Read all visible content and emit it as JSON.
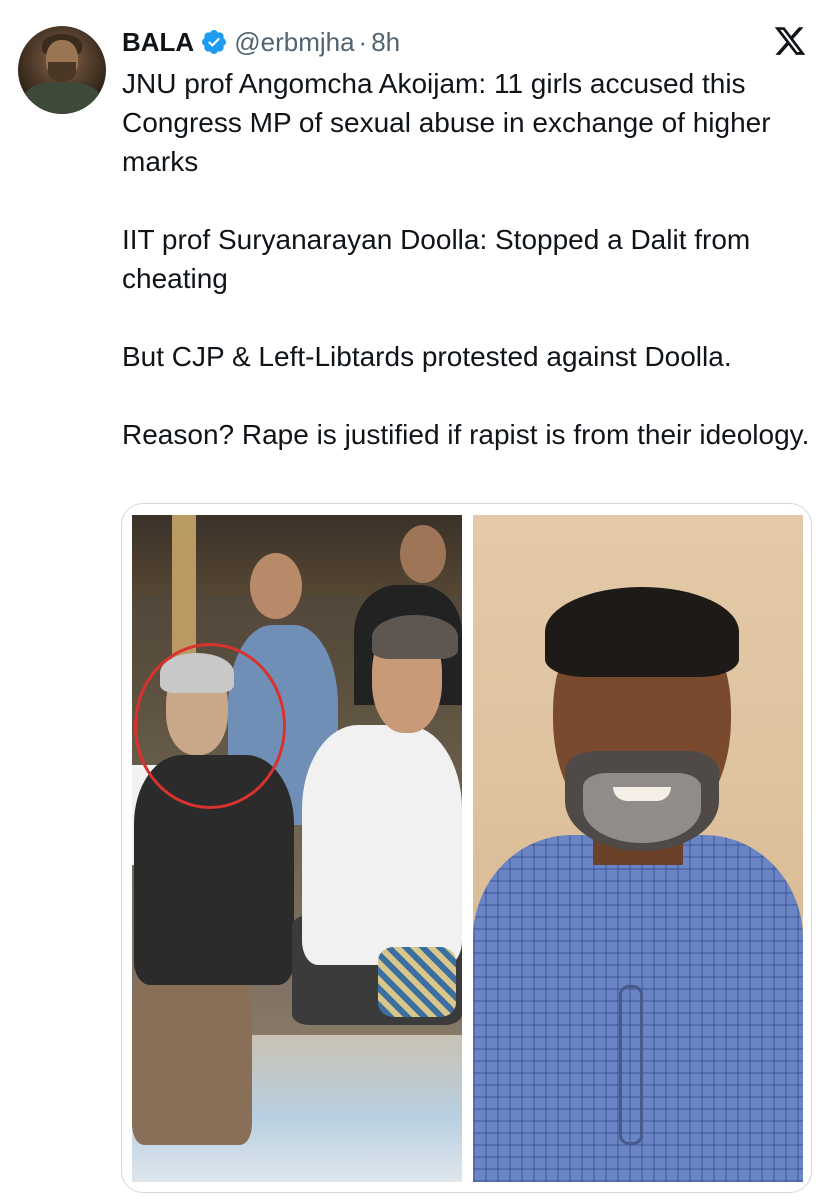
{
  "tweet": {
    "author_name": "BALA",
    "handle": "@erbmjha",
    "separator": "·",
    "time": "8h",
    "paragraphs": [
      "JNU prof Angomcha Akoijam: 11 girls accused this Congress MP of sexual abuse in exchange of higher marks",
      "IIT prof Suryanarayan Doolla: Stopped a Dalit from cheating",
      "But CJP & Left-Libtards protested against Doolla.",
      "Reason? Rape is justified if rapist is from their ideology."
    ]
  },
  "icons": {
    "verified": "verified-badge-icon",
    "platform": "x-logo-icon"
  },
  "colors": {
    "text": "#0f1419",
    "secondary_text": "#536471",
    "verified_blue": "#1d9bf0",
    "annotation_circle": "#d9322e"
  }
}
